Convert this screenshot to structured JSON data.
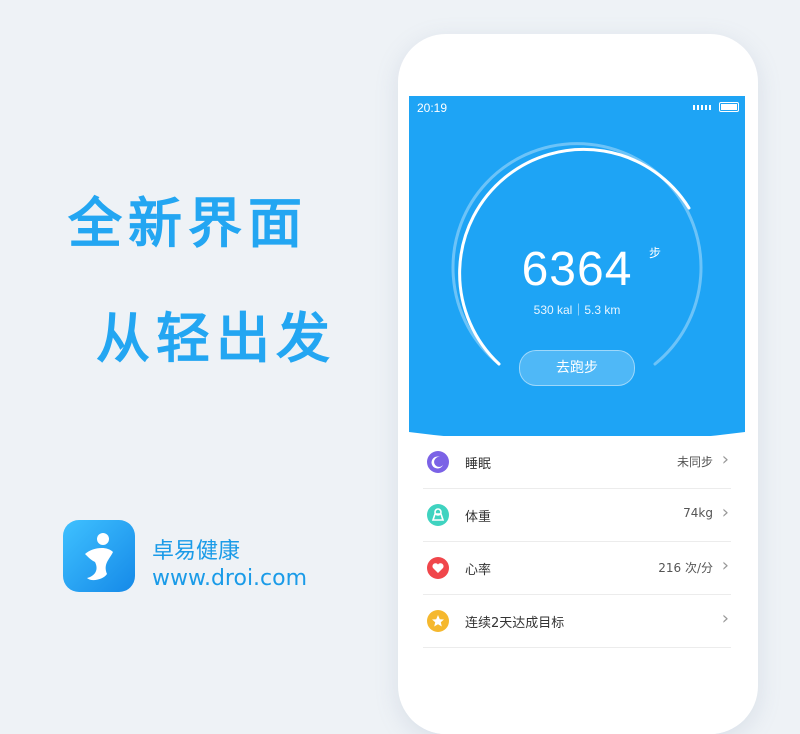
{
  "headline": {
    "line1": "全新界面",
    "line2": "从轻出发"
  },
  "brand": {
    "name": "卓易健康",
    "url": "www.droi.com"
  },
  "status_bar": {
    "time": "20:19"
  },
  "hero": {
    "steps": "6364",
    "steps_unit": "步",
    "summary": "530 kal｜5.3 km",
    "run_button": "去跑步"
  },
  "list": [
    {
      "label": "睡眠",
      "value": "未同步",
      "icon": "moon-icon",
      "color": "#7b62e6"
    },
    {
      "label": "体重",
      "value": "74kg",
      "icon": "scale-icon",
      "color": "#3fd3c0"
    },
    {
      "label": "心率",
      "value": "216 次/分",
      "icon": "heart-icon",
      "color": "#f0464b"
    },
    {
      "label": "连续2天达成目标",
      "value": "",
      "icon": "star-icon",
      "color": "#f5b82e"
    }
  ],
  "colors": {
    "accent": "#1ea4f5",
    "headline": "#23a6f2"
  }
}
